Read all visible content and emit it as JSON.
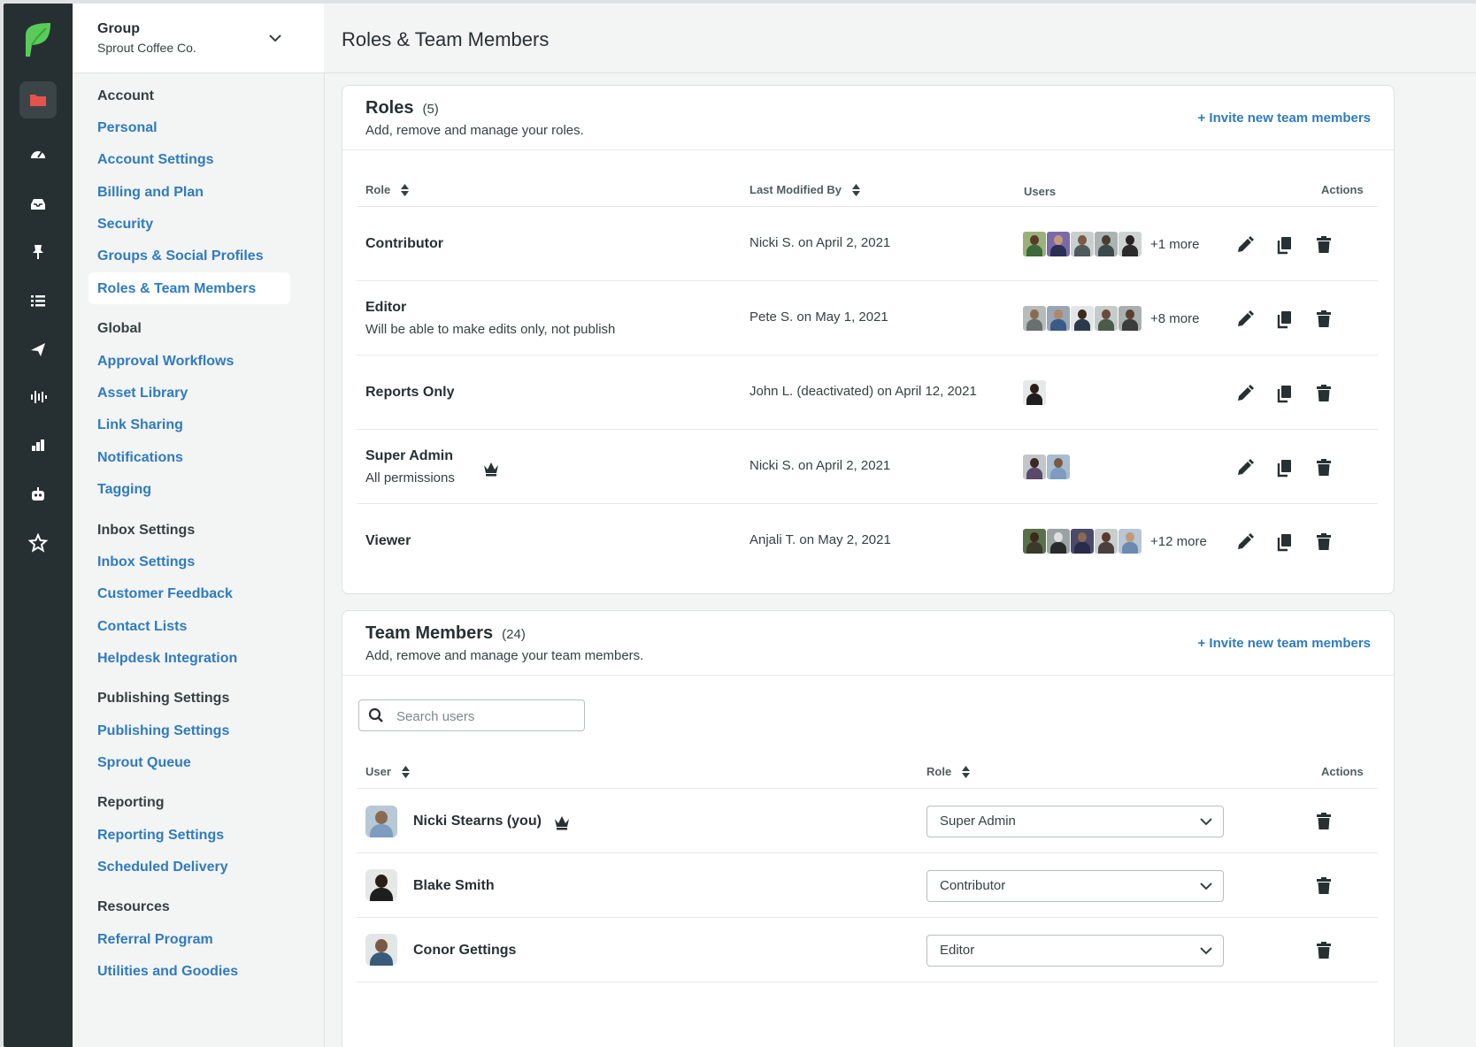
{
  "rail": {
    "icons": [
      "sprout-logo-icon",
      "folder-icon",
      "dashboard-icon",
      "inbox-icon",
      "pin-icon",
      "list-icon",
      "send-icon",
      "listening-icon",
      "reports-icon",
      "bot-icon",
      "star-icon"
    ]
  },
  "group_selector": {
    "label": "Group",
    "value": "Sprout Coffee Co."
  },
  "nav": {
    "account_header": "Account",
    "account": [
      "Personal",
      "Account Settings",
      "Billing and Plan",
      "Security",
      "Groups & Social Profiles",
      "Roles & Team Members"
    ],
    "global_header": "Global",
    "global": [
      "Approval Workflows",
      "Asset Library",
      "Link Sharing",
      "Notifications",
      "Tagging"
    ],
    "inbox_header": "Inbox Settings",
    "inbox": [
      "Inbox Settings",
      "Customer Feedback",
      "Contact Lists",
      "Helpdesk Integration"
    ],
    "publishing_header": "Publishing Settings",
    "publishing": [
      "Publishing Settings",
      "Sprout Queue"
    ],
    "reporting_header": "Reporting",
    "reporting": [
      "Reporting Settings",
      "Scheduled Delivery"
    ],
    "resources_header": "Resources",
    "resources": [
      "Referral Program",
      "Utilities and Goodies"
    ]
  },
  "page_title": "Roles & Team Members",
  "roles_card": {
    "title": "Roles",
    "count": "(5)",
    "subtitle": "Add, remove and manage your roles.",
    "invite": "+ Invite new team members",
    "headers": {
      "role": "Role",
      "modified": "Last Modified By",
      "users": "Users",
      "actions": "Actions"
    },
    "rows": [
      {
        "name": "Contributor",
        "desc": "",
        "modified": "Nicki S. on April 2, 2021",
        "more": "+1 more"
      },
      {
        "name": "Editor",
        "desc": "Will be able to make edits only, not publish",
        "modified": "Pete S. on May 1, 2021",
        "more": "+8 more"
      },
      {
        "name": "Reports Only",
        "desc": "",
        "modified": "John L. (deactivated) on April 12, 2021",
        "more": ""
      },
      {
        "name": "Super Admin",
        "desc": "All permissions",
        "modified": "Nicki S. on April 2, 2021",
        "more": ""
      },
      {
        "name": "Viewer",
        "desc": "",
        "modified": "Anjali T. on May 2, 2021",
        "more": "+12 more"
      }
    ]
  },
  "team_card": {
    "title": "Team Members",
    "count": "(24)",
    "subtitle": "Add, remove and manage your team members.",
    "invite": "+ Invite new team members",
    "search_placeholder": "Search users",
    "headers": {
      "user": "User",
      "role": "Role",
      "actions": "Actions"
    },
    "rows": [
      {
        "name": "Nicki Stearns (you)",
        "role": "Super Admin"
      },
      {
        "name": "Blake Smith",
        "role": "Contributor"
      },
      {
        "name": "Conor Gettings",
        "role": "Editor"
      }
    ]
  },
  "colors": {
    "rail": "#263033",
    "link": "#2f7bbf",
    "brand_green": "#59cb59",
    "folder_red": "#e5534b"
  }
}
